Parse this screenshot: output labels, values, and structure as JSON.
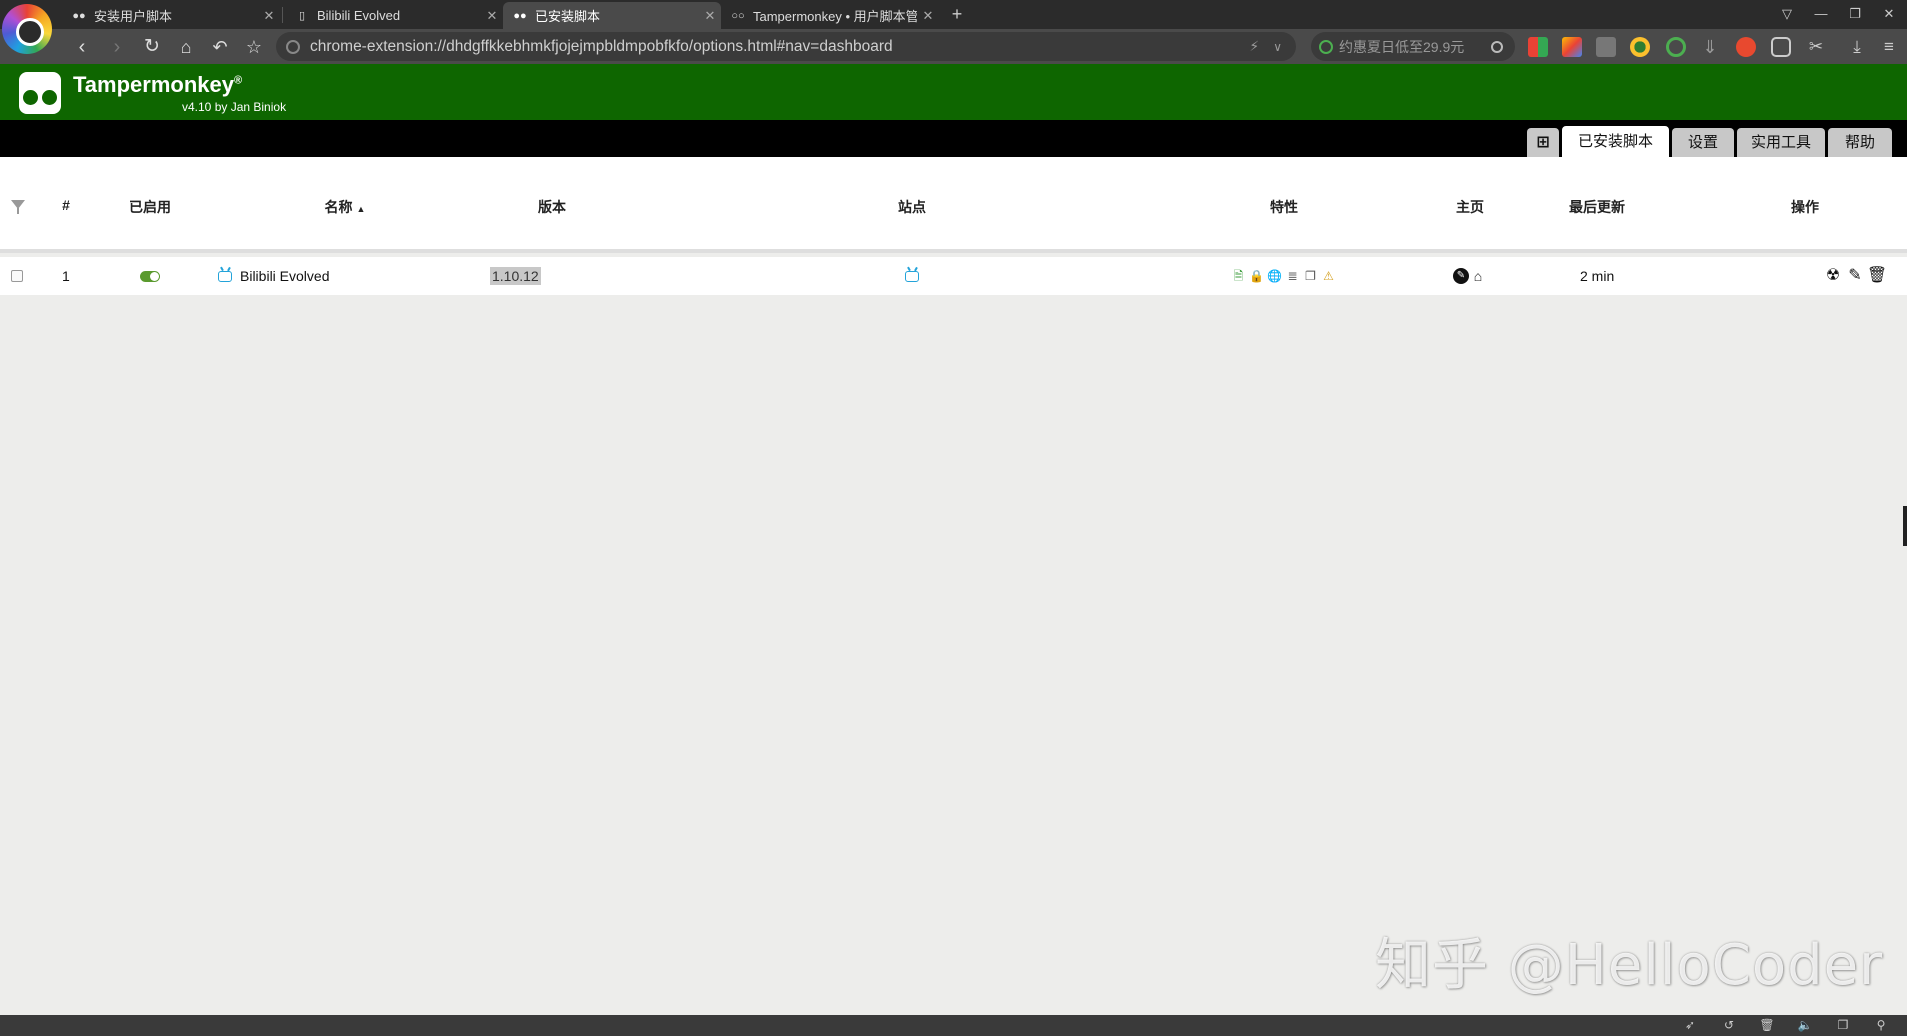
{
  "browser": {
    "tabs": [
      {
        "title": "安装用户脚本",
        "icon": "tampermonkey-icon",
        "active": false
      },
      {
        "title": "Bilibili Evolved",
        "icon": "page-icon",
        "active": false
      },
      {
        "title": "已安装脚本",
        "icon": "tampermonkey-icon",
        "active": true
      },
      {
        "title": "Tampermonkey • 用户脚本管",
        "icon": "tampermonkey-icon",
        "active": false
      }
    ],
    "new_tab": "+",
    "address": "chrome-extension://dhdgffkkebhmkfjojejmpbldmpobfkfo/options.html#nav=dashboard",
    "search_placeholder": "约惠夏日低至29.9元"
  },
  "app": {
    "name": "Tampermonkey",
    "trademark": "®",
    "version_line": "v4.10 by Jan Biniok",
    "brand_color": "#0e6600"
  },
  "nav_tabs": {
    "plus": "⊞",
    "installed": "已安装脚本",
    "settings": "设置",
    "utilities": "实用工具",
    "help": "帮助"
  },
  "table": {
    "headers": {
      "num": "#",
      "enabled": "已启用",
      "name": "名称",
      "version": "版本",
      "sites": "站点",
      "features": "特性",
      "homepage": "主页",
      "last_updated": "最后更新",
      "actions": "操作"
    },
    "rows": [
      {
        "num": "1",
        "enabled": true,
        "name": "Bilibili Evolved",
        "version": "1.10.12",
        "site_icon": "tv-icon",
        "features": [
          "file-icon",
          "lock-icon",
          "globe-icon",
          "database-icon",
          "window-icon",
          "warning-icon"
        ],
        "last_updated": "2 min"
      }
    ]
  },
  "watermark": "知乎 @HelloCoder"
}
